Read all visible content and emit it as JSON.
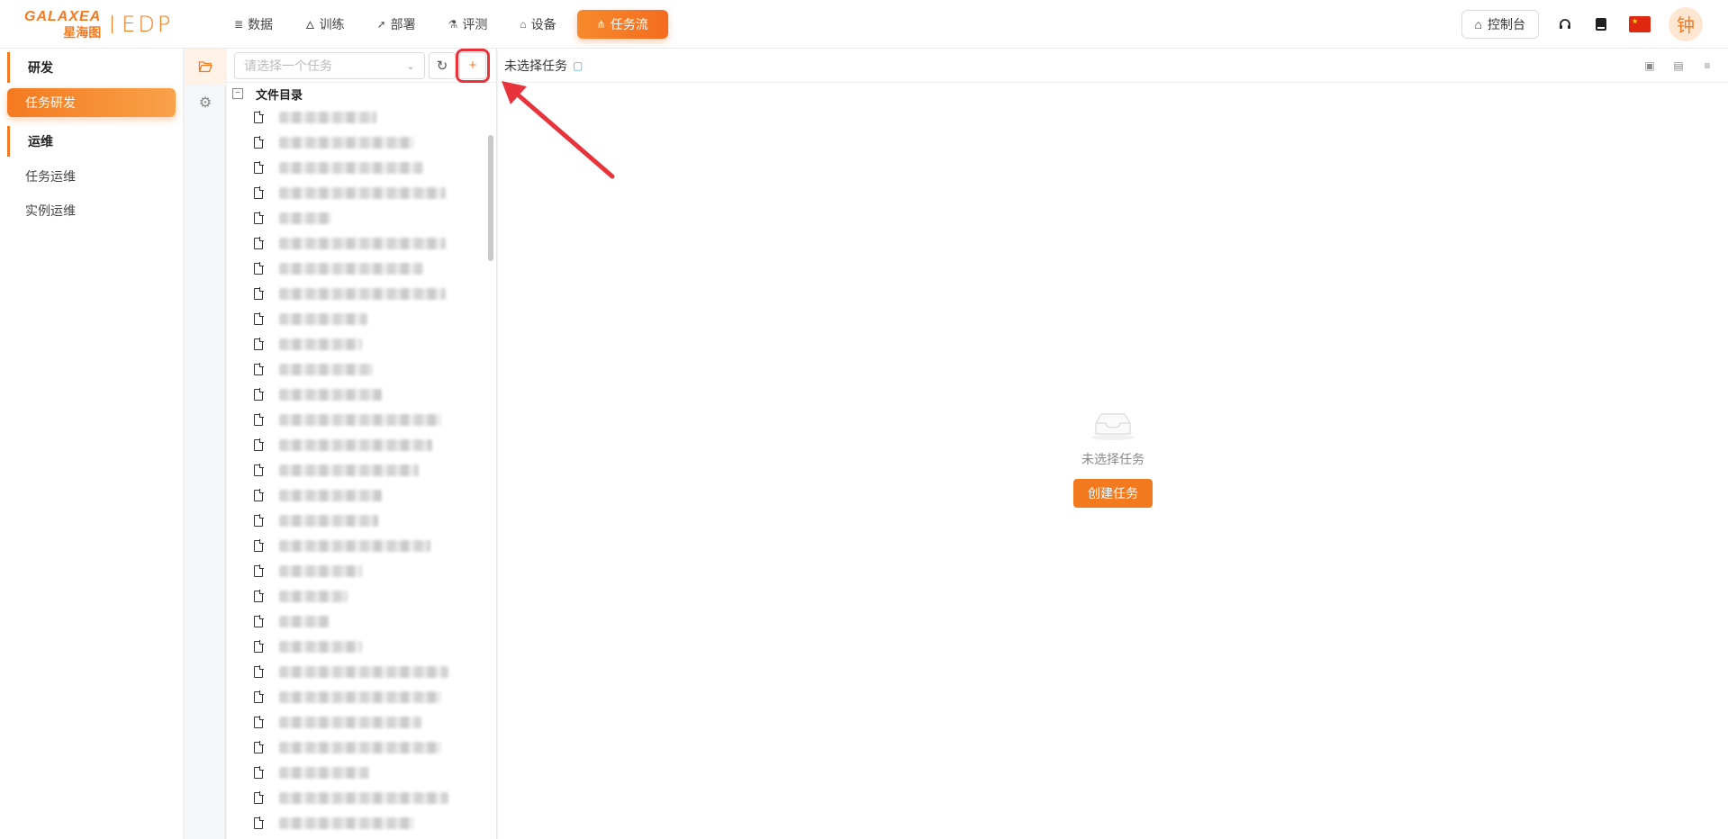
{
  "header": {
    "logo_en": "GALAXEA",
    "logo_cn": "星海图",
    "logo_product": "EDP",
    "nav": [
      {
        "label": "数据",
        "icon": "database-icon",
        "glyph": "≣"
      },
      {
        "label": "训练",
        "icon": "flame-icon",
        "glyph": "🜂"
      },
      {
        "label": "部署",
        "icon": "rocket-icon",
        "glyph": "➚"
      },
      {
        "label": "评测",
        "icon": "flask-icon",
        "glyph": "⚗"
      },
      {
        "label": "设备",
        "icon": "robot-icon",
        "glyph": "⌂"
      },
      {
        "label": "任务流",
        "icon": "workflow-icon",
        "glyph": "⋔",
        "active": true
      }
    ],
    "console_label": "控制台",
    "avatar_text": "钟"
  },
  "sidebar": {
    "section_dev": "研发",
    "item_task_dev": "任务研发",
    "section_ops": "运维",
    "item_task_ops": "任务运维",
    "item_instance_ops": "实例运维"
  },
  "tree": {
    "select_placeholder": "请选择一个任务",
    "root_label": "文件目录",
    "row_widths": [
      108,
      150,
      160,
      185,
      58,
      185,
      160,
      185,
      98,
      92,
      104,
      114,
      180,
      170,
      155,
      114,
      110,
      168,
      92,
      76,
      56,
      92,
      188,
      180,
      158,
      180,
      100,
      188,
      150
    ]
  },
  "main": {
    "title": "未选择任务",
    "empty_text": "未选择任务",
    "create_button": "创建任务"
  },
  "colors": {
    "accent": "#f47a1f",
    "highlight_red": "#e8333b"
  }
}
